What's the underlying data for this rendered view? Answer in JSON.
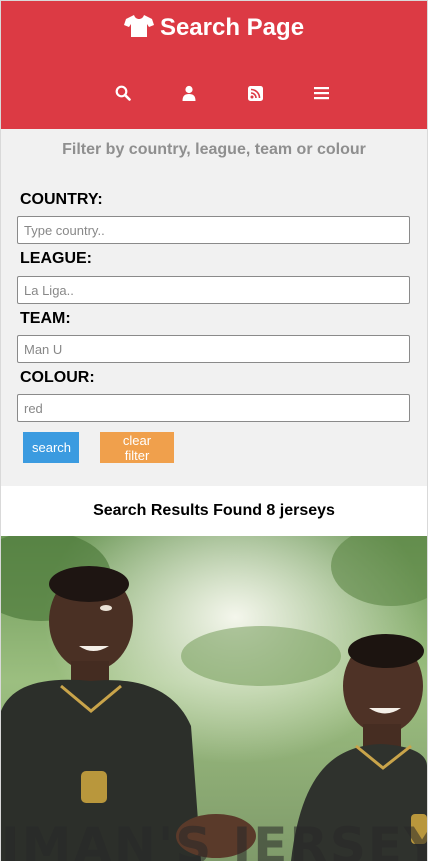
{
  "header": {
    "title": "Search Page",
    "title_icon": "tshirt-icon",
    "brand_color": "#dc3a44",
    "nav": [
      {
        "icon": "search-icon"
      },
      {
        "icon": "user-icon"
      },
      {
        "icon": "rss-icon"
      },
      {
        "icon": "menu-icon"
      }
    ]
  },
  "filter": {
    "heading": "Filter by country, league, team or colour",
    "fields": {
      "country": {
        "label": "COUNTRY:",
        "placeholder": "Type country..",
        "value": ""
      },
      "league": {
        "label": "LEAGUE:",
        "placeholder": "La Liga..",
        "value": ""
      },
      "team": {
        "label": "TEAM:",
        "placeholder": "Man U",
        "value": ""
      },
      "colour": {
        "label": "COLOUR:",
        "placeholder": "red",
        "value": ""
      }
    },
    "search_label": "search",
    "clear_label": "clear filter",
    "search_color": "#3b9be0",
    "clear_color": "#f0a04c"
  },
  "results": {
    "heading": "Search Results Found 8 jerseys",
    "first_card": {
      "overlay_text": "IMAN'S JERSEYS"
    }
  }
}
